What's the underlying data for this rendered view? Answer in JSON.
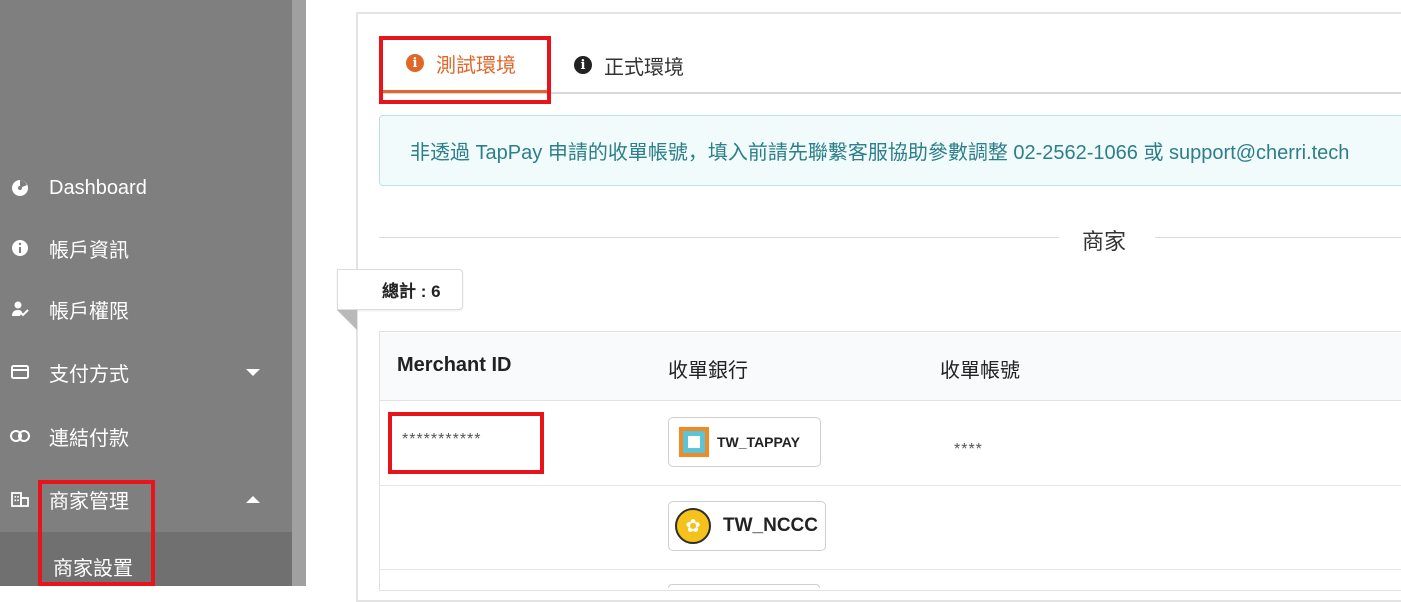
{
  "sidebar": {
    "items": [
      {
        "label": "Dashboard",
        "icon": "dashboard-icon"
      },
      {
        "label": "帳戶資訊",
        "icon": "info-icon"
      },
      {
        "label": "帳戶權限",
        "icon": "user-check-icon"
      },
      {
        "label": "支付方式",
        "icon": "credit-card-icon"
      },
      {
        "label": "連結付款",
        "icon": "link-icon"
      },
      {
        "label": "商家管理",
        "icon": "building-icon"
      }
    ],
    "sub_item": "商家設置"
  },
  "tabs": [
    {
      "label": "測試環境",
      "active": true
    },
    {
      "label": "正式環境",
      "active": false
    }
  ],
  "alert": {
    "text": "非透過 TapPay 申請的收單帳號，填入前請先聯繫客服協助參數調整 02-2562-1066 或 support@cherri.tech"
  },
  "section": {
    "title": "商家",
    "total_label": "總計 : 6"
  },
  "table": {
    "columns": [
      "Merchant ID",
      "收單銀行",
      "收單帳號"
    ],
    "rows": [
      {
        "merchant_id": "***********",
        "bank": "TW_TAPPAY",
        "account": "****"
      },
      {
        "merchant_id": "",
        "bank": "TW_NCCC",
        "account": ""
      }
    ]
  },
  "colors": {
    "accent": "#e0672a",
    "highlight_box": "#e8141c",
    "alert_text": "#2c7f8a",
    "sidebar_bg": "#7f7f7f"
  }
}
